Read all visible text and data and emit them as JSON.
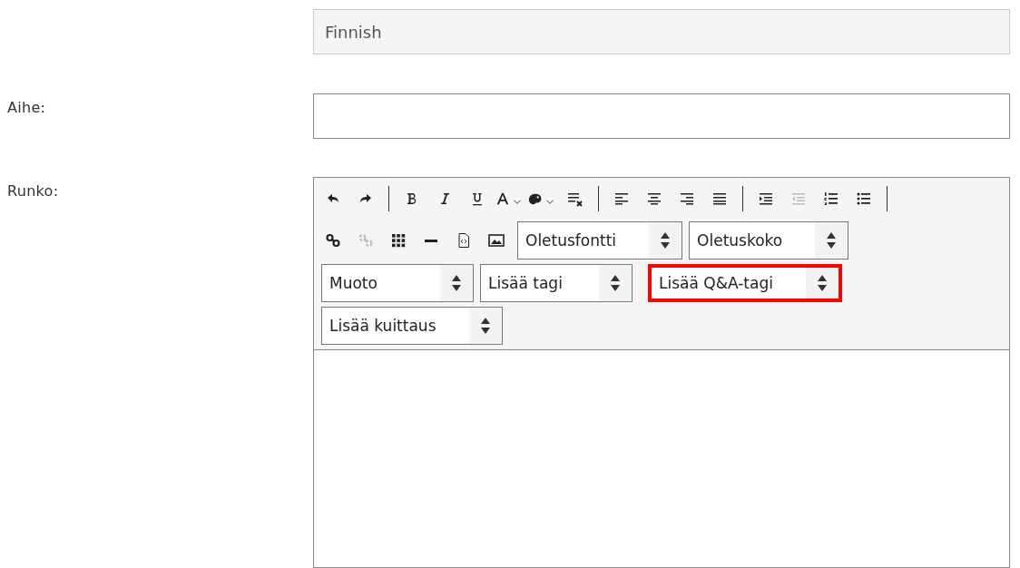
{
  "language_field": {
    "value": "Finnish"
  },
  "subject": {
    "label": "Aihe:"
  },
  "body": {
    "label": "Runko:",
    "toolbar_rows": [
      [
        {
          "kind": "undo",
          "disabled": false
        },
        {
          "kind": "redo",
          "disabled": false
        },
        {
          "kind": "separator"
        },
        {
          "kind": "bold",
          "disabled": false
        },
        {
          "kind": "italic",
          "disabled": false
        },
        {
          "kind": "underline",
          "disabled": false
        },
        {
          "kind": "font-color",
          "disabled": false
        },
        {
          "kind": "bg-color",
          "disabled": false
        },
        {
          "kind": "clear-format",
          "disabled": false
        },
        {
          "kind": "separator"
        },
        {
          "kind": "align-left",
          "disabled": false
        },
        {
          "kind": "align-center",
          "disabled": false
        },
        {
          "kind": "align-right",
          "disabled": false
        },
        {
          "kind": "justify",
          "disabled": false
        },
        {
          "kind": "separator"
        },
        {
          "kind": "indent",
          "disabled": false
        },
        {
          "kind": "outdent",
          "disabled": true
        },
        {
          "kind": "ordered-list",
          "disabled": false
        },
        {
          "kind": "bullet-list",
          "disabled": false
        },
        {
          "kind": "separator"
        }
      ],
      [
        {
          "kind": "link",
          "disabled": false
        },
        {
          "kind": "unlink",
          "disabled": true
        },
        {
          "kind": "table",
          "disabled": false
        },
        {
          "kind": "rule",
          "disabled": false
        },
        {
          "kind": "source",
          "disabled": false
        },
        {
          "kind": "image",
          "disabled": false
        },
        {
          "kind": "select",
          "label": "Oletusfontti",
          "highlighted": false
        },
        {
          "kind": "select",
          "label": "Oletuskoko",
          "highlighted": false
        }
      ],
      [
        {
          "kind": "select",
          "label": "Muoto",
          "highlighted": false
        },
        {
          "kind": "select",
          "label": "Lisää tagi",
          "highlighted": false
        },
        {
          "kind": "select",
          "label": "Lisää Q&A-tagi",
          "highlighted": true
        }
      ],
      [
        {
          "kind": "select",
          "label": "Lisää kuittaus",
          "highlighted": false
        }
      ]
    ]
  }
}
